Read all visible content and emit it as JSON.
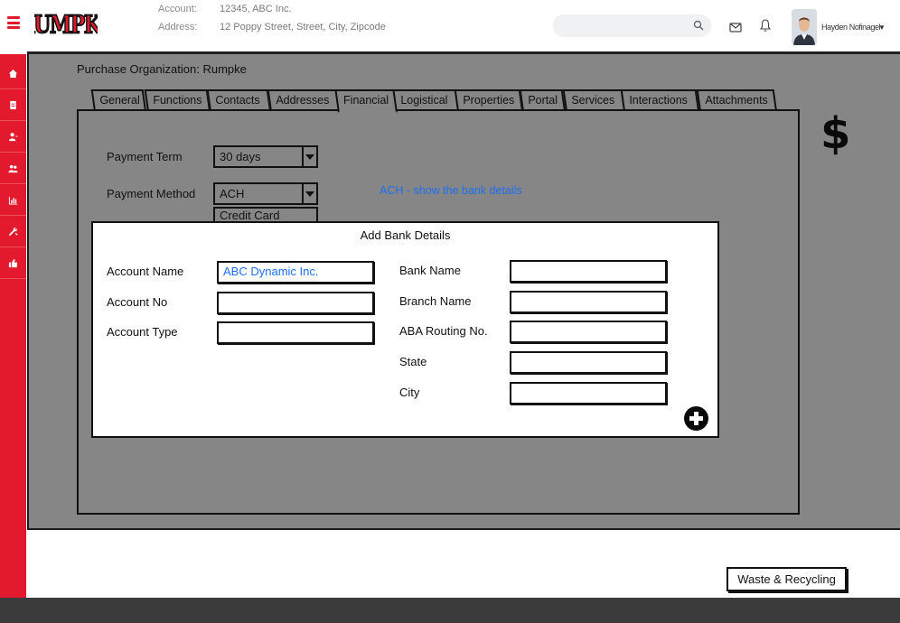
{
  "header": {
    "logo_text": "RUMPKE",
    "account_label": "Account:",
    "account_value": "12345, ABC Inc.",
    "address_label": "Address:",
    "address_value": "12 Poppy Street, Street, City, Zipcode",
    "search_placeholder": "",
    "user_name": "Hayden Nofinagel"
  },
  "sidebar": {
    "items": [
      {
        "icon": "home-icon"
      },
      {
        "icon": "document-icon"
      },
      {
        "icon": "user-icon"
      },
      {
        "icon": "users-icon"
      },
      {
        "icon": "chart-icon"
      },
      {
        "icon": "tools-icon"
      },
      {
        "icon": "thumbs-up-icon"
      }
    ]
  },
  "main": {
    "org_line": "Purchase Organization: Rumpke",
    "tabs": [
      {
        "label": "General"
      },
      {
        "label": "Functions"
      },
      {
        "label": "Contacts"
      },
      {
        "label": "Addresses"
      },
      {
        "label": "Financial"
      },
      {
        "label": "Logistical"
      },
      {
        "label": "Properties"
      },
      {
        "label": "Portal"
      },
      {
        "label": "Services"
      },
      {
        "label": "Interactions"
      },
      {
        "label": "Attachments"
      }
    ],
    "active_tab": "Financial",
    "currency_symbol": "$",
    "payment_term_label": "Payment Term",
    "payment_term_value": "30 days",
    "payment_method_label": "Payment Method",
    "payment_method_value": "ACH",
    "payment_method_option": "Credit Card",
    "note": "ACH - show the bank details"
  },
  "modal": {
    "title": "Add Bank Details",
    "account_name_label": "Account Name",
    "account_name_value": "ABC Dynamic Inc.",
    "account_no_label": "Account No",
    "account_no_value": "",
    "account_type_label": "Account Type",
    "account_type_value": "",
    "bank_name_label": "Bank Name",
    "bank_name_value": "",
    "branch_name_label": "Branch Name",
    "branch_name_value": "",
    "aba_label": "ABA Routing No.",
    "aba_value": "",
    "state_label": "State",
    "state_value": "",
    "city_label": "City",
    "city_value": ""
  },
  "footer_button": "Waste & Recycling",
  "colors": {
    "brand_red": "#e3192d",
    "panel_grey": "#868686",
    "link_blue": "#1f6ff0",
    "footer_dark": "#3b3b3b"
  }
}
